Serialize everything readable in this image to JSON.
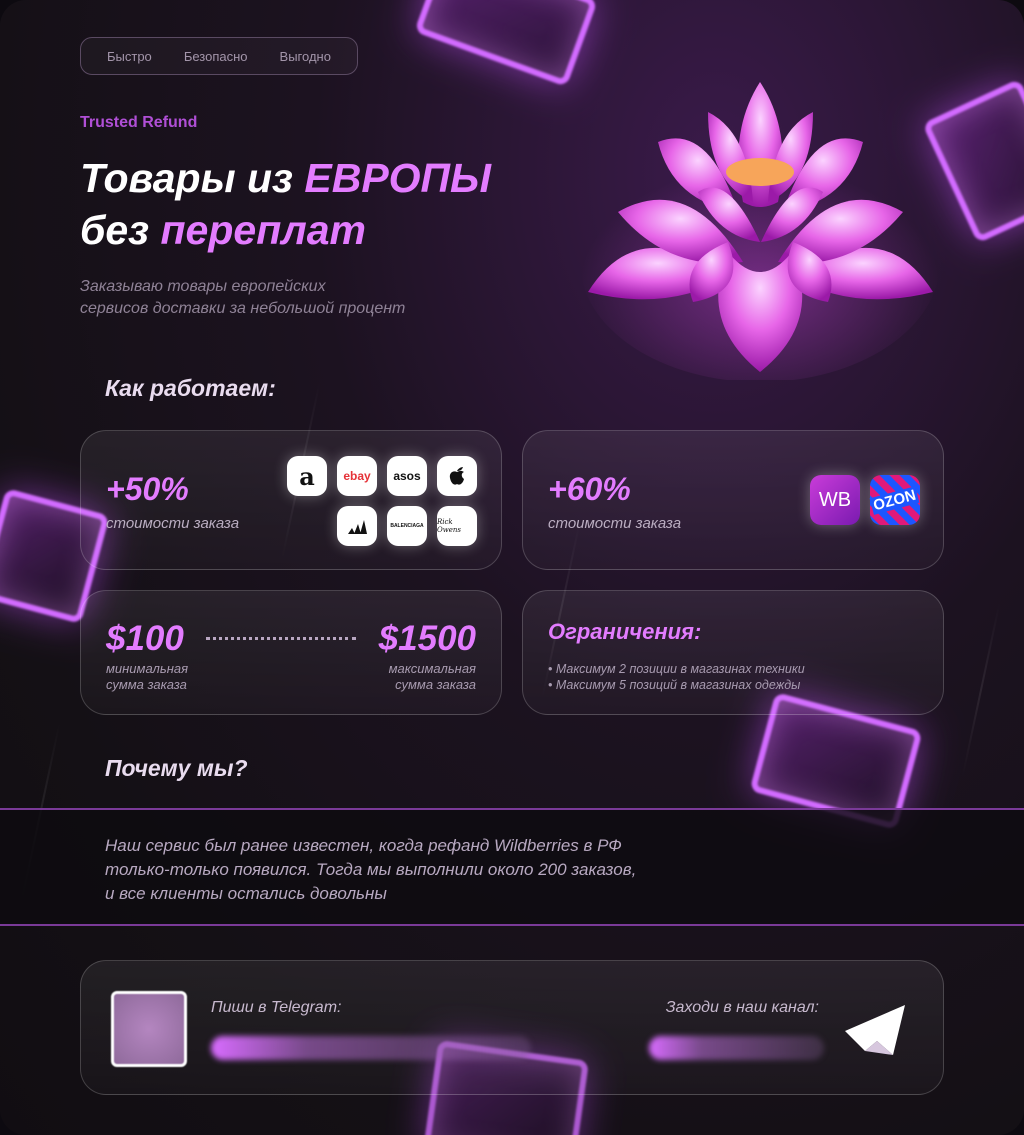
{
  "nav": {
    "items": [
      "Быстро",
      "Безопасно",
      "Выгодно"
    ]
  },
  "brand": "Trusted Refund",
  "hero": {
    "line1_a": "Товары из ",
    "line1_b": "ЕВРОПЫ",
    "line2_a": "без ",
    "line2_b": "переплат",
    "subtitle_1": "Заказываю товары европейских",
    "subtitle_2": "сервисов доставки за небольшой процент"
  },
  "how": {
    "title": "Как работаем:",
    "card1": {
      "value": "+50%",
      "caption": "стоимости заказа",
      "stores": [
        {
          "name": "amazon-logo",
          "label": "a"
        },
        {
          "name": "ebay-logo",
          "label": "ebay"
        },
        {
          "name": "asos-logo",
          "label": "asos"
        },
        {
          "name": "apple-logo",
          "label": ""
        },
        {
          "name": "adidas-logo",
          "label": ""
        },
        {
          "name": "balenciaga-logo",
          "label": "BALENCIAGA"
        },
        {
          "name": "rick-owens-logo",
          "label": "Rick Owens"
        }
      ]
    },
    "card2": {
      "value": "+60%",
      "caption": "стоимости заказа",
      "wb": "WB",
      "ozon": "OZON"
    },
    "card3": {
      "min": "$100",
      "max": "$1500",
      "min_cap_1": "минимальная",
      "min_cap_2": "сумма заказа",
      "max_cap_1": "максимальная",
      "max_cap_2": "сумма заказа"
    },
    "card4": {
      "title": "Ограничения:",
      "items": [
        "• Максимум 2 позиции в магазинах техники",
        "• Максимум 5 позиций в магазинах одежды"
      ]
    }
  },
  "why": {
    "title": "Почему мы?",
    "text_1": "Наш сервис был ранее известен, когда рефанд Wildberries в РФ",
    "text_2": "только-только появился. Тогда мы выполнили около 200 заказов,",
    "text_3": "и все клиенты остались довольны"
  },
  "contact": {
    "telegram_label": "Пиши в Telegram:",
    "channel_label": "Заходи в наш канал:"
  },
  "colors": {
    "accent": "#e37cff",
    "brand": "#b04fd6",
    "wb": "#a12ad0",
    "ozon": "#1d56ff"
  }
}
